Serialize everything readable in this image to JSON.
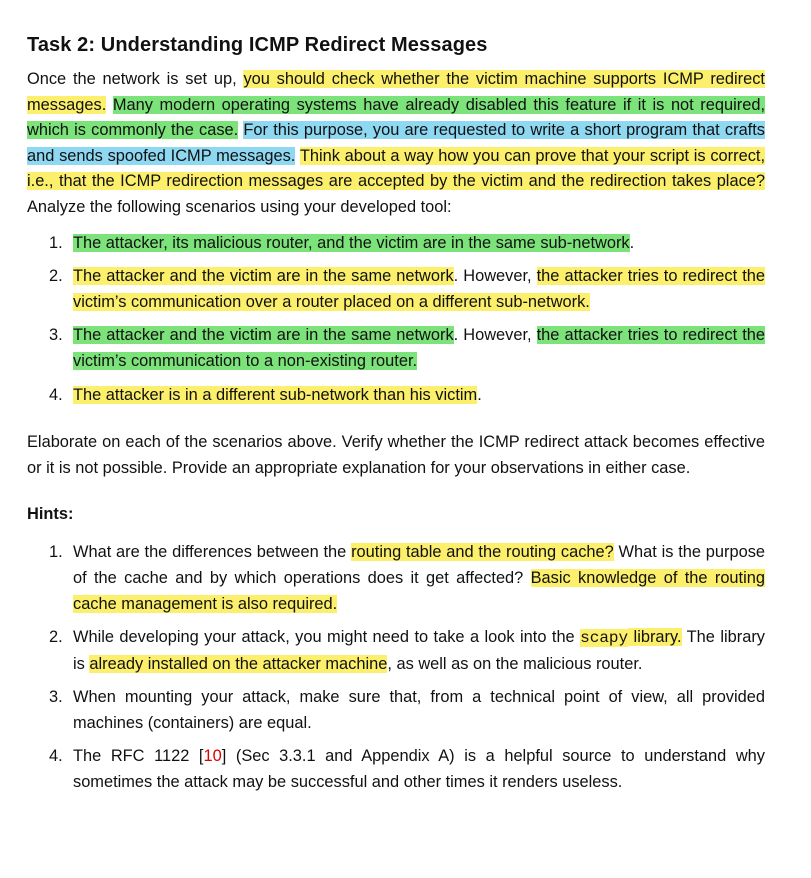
{
  "title": "Task 2: Understanding ICMP Redirect Messages",
  "intro": {
    "p1": "Once the network is set up, ",
    "p2": "you should check whether the victim machine supports ICMP redirect messages.",
    "p3": " ",
    "p4": "Many modern operating systems have already disabled this feature if it is not required, which is commonly the case.",
    "p5": " ",
    "p6": "For this purpose, you are requested to write a short program that crafts and sends spoofed ICMP messages.",
    "p7": " ",
    "p8": "Think about a way how you can prove that your script is correct, i.e., that the ICMP redirection messages are accepted by the victim and the redirection takes place?",
    "p9": " Analyze the following scenarios using your developed tool:"
  },
  "scenarios": [
    {
      "num": "1.",
      "a": "The attacker, its malicious router, and the victim are in the same sub-network",
      "b": "."
    },
    {
      "num": "2.",
      "a": "The attacker and the victim are in the same network",
      "b": ". However, ",
      "c": "the attacker tries to redirect the victim’s communication over a router placed on a different sub-network."
    },
    {
      "num": "3.",
      "a": "The attacker and the victim are in the same network",
      "b": ". However, ",
      "c": "the attacker tries to redirect the victim’s communication to a non-existing router."
    },
    {
      "num": "4.",
      "a": "The attacker is in a different sub-network than his victim",
      "b": "."
    }
  ],
  "elaborate": "Elaborate on each of the scenarios above.  Verify whether the ICMP redirect attack becomes effective or it is not possible. Provide an appropriate explanation for your observations in either case.",
  "hints_title": "Hints:",
  "hints": [
    {
      "num": "1.",
      "t1": "What are the differences between the ",
      "h1": "routing table and the routing cache?",
      "t2": "  What is the purpose of the cache and by which operations does it get affected? ",
      "h2": "Basic knowledge of the routing cache management is also required."
    },
    {
      "num": "2.",
      "t1": "While developing your attack, you might need to take a look into the ",
      "code": "scapy",
      "h1": " library.",
      "t2": " The library is ",
      "h2": "already installed on the attacker machine",
      "t3": ", as well as on the malicious router."
    },
    {
      "num": "3.",
      "t1": "When mounting your attack, make sure that, from a technical point of view, all provided machines (containers) are equal."
    },
    {
      "num": "4.",
      "t1": "The RFC 1122 [",
      "cite": "10",
      "t2": "] (Sec 3.3.1 and Appendix A) is a helpful source to understand why sometimes the attack may be successful and other times it renders useless."
    }
  ],
  "colors": {
    "yellow": "#fbef6b",
    "green": "#7ce27a",
    "blue": "#8fd8f2",
    "cite": "#e00000"
  }
}
